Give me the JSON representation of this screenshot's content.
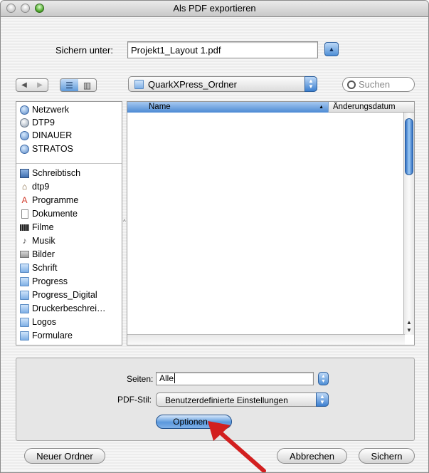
{
  "window": {
    "title": "Als PDF exportieren"
  },
  "save_as": {
    "label": "Sichern unter:",
    "value": "Projekt1_Layout 1.pdf"
  },
  "toolbar": {
    "back_glyph": "◀",
    "forward_glyph": "▶",
    "list_view_glyph": "☰",
    "column_view_glyph": "▥",
    "location": "QuarkXPress_Ordner",
    "search_placeholder": "Suchen"
  },
  "sidebar": {
    "network": [
      {
        "label": "Netzwerk",
        "icon": "network-icon"
      },
      {
        "label": "DTP9",
        "icon": "disk-icon"
      },
      {
        "label": "DINAUER",
        "icon": "server-icon"
      },
      {
        "label": "STRATOS",
        "icon": "server-icon"
      }
    ],
    "places": [
      {
        "label": "Schreibtisch",
        "icon": "desktop-icon"
      },
      {
        "label": "dtp9",
        "icon": "home-icon"
      },
      {
        "label": "Programme",
        "icon": "applications-icon"
      },
      {
        "label": "Dokumente",
        "icon": "document-icon"
      },
      {
        "label": "Filme",
        "icon": "movie-icon"
      },
      {
        "label": "Musik",
        "icon": "music-icon"
      },
      {
        "label": "Bilder",
        "icon": "pictures-icon"
      },
      {
        "label": "Schrift",
        "icon": "folder-icon"
      },
      {
        "label": "Progress",
        "icon": "folder-icon"
      },
      {
        "label": "Progress_Digital",
        "icon": "folder-icon"
      },
      {
        "label": "Druckerbeschrei…",
        "icon": "folder-icon"
      },
      {
        "label": "Logos",
        "icon": "folder-icon"
      },
      {
        "label": "Formulare",
        "icon": "folder-icon"
      }
    ]
  },
  "file_list": {
    "columns": [
      {
        "label": "Name",
        "sorted": true
      },
      {
        "label": "Änderungsdatum",
        "sorted": false
      }
    ]
  },
  "options": {
    "pages_label": "Seiten:",
    "pages_value": "Alle",
    "pdf_style_label": "PDF-Stil:",
    "pdf_style_value": "Benutzerdefinierte Einstellungen",
    "options_button": "Optionen..."
  },
  "footer": {
    "new_folder": "Neuer Ordner",
    "cancel": "Abbrechen",
    "save": "Sichern"
  },
  "colors": {
    "accent_blue": "#3b7fcf",
    "annotation_arrow": "#d21f1f"
  }
}
